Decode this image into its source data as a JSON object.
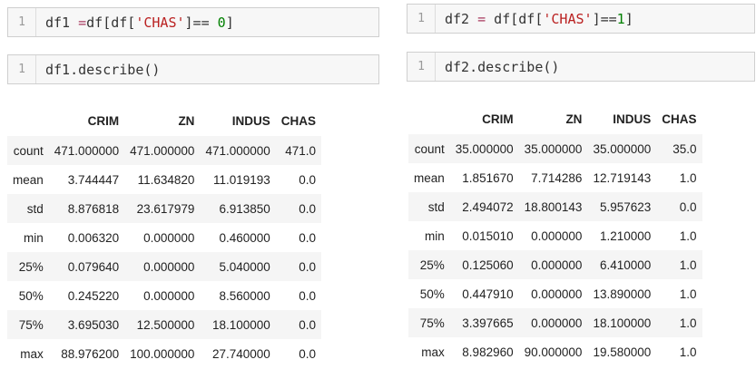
{
  "left": {
    "cell1": {
      "num": "1",
      "code_prefix": "df1 ",
      "code_eq": "=",
      "code_mid": "df[df[",
      "code_str": "'CHAS'",
      "code_cmp": "]== ",
      "code_num": "0",
      "code_end": "]"
    },
    "cell2": {
      "num": "1",
      "code": "df1.describe()"
    },
    "table": {
      "columns": [
        "CRIM",
        "ZN",
        "INDUS",
        "CHAS"
      ],
      "rows": [
        {
          "label": "count",
          "values": [
            "471.000000",
            "471.000000",
            "471.000000",
            "471.0"
          ]
        },
        {
          "label": "mean",
          "values": [
            "3.744447",
            "11.634820",
            "11.019193",
            "0.0"
          ]
        },
        {
          "label": "std",
          "values": [
            "8.876818",
            "23.617979",
            "6.913850",
            "0.0"
          ]
        },
        {
          "label": "min",
          "values": [
            "0.006320",
            "0.000000",
            "0.460000",
            "0.0"
          ]
        },
        {
          "label": "25%",
          "values": [
            "0.079640",
            "0.000000",
            "5.040000",
            "0.0"
          ]
        },
        {
          "label": "50%",
          "values": [
            "0.245220",
            "0.000000",
            "8.560000",
            "0.0"
          ]
        },
        {
          "label": "75%",
          "values": [
            "3.695030",
            "12.500000",
            "18.100000",
            "0.0"
          ]
        },
        {
          "label": "max",
          "values": [
            "88.976200",
            "100.000000",
            "27.740000",
            "0.0"
          ]
        }
      ]
    }
  },
  "right": {
    "cell1": {
      "num": "1",
      "code_prefix": "df2 ",
      "code_eq": "=",
      "code_mid": " df[df[",
      "code_str": "'CHAS'",
      "code_cmp": "]==",
      "code_num": "1",
      "code_end": "]"
    },
    "cell2": {
      "num": "1",
      "code": "df2.describe()"
    },
    "table": {
      "columns": [
        "CRIM",
        "ZN",
        "INDUS",
        "CHAS"
      ],
      "rows": [
        {
          "label": "count",
          "values": [
            "35.000000",
            "35.000000",
            "35.000000",
            "35.0"
          ]
        },
        {
          "label": "mean",
          "values": [
            "1.851670",
            "7.714286",
            "12.719143",
            "1.0"
          ]
        },
        {
          "label": "std",
          "values": [
            "2.494072",
            "18.800143",
            "5.957623",
            "0.0"
          ]
        },
        {
          "label": "min",
          "values": [
            "0.015010",
            "0.000000",
            "1.210000",
            "1.0"
          ]
        },
        {
          "label": "25%",
          "values": [
            "0.125060",
            "0.000000",
            "6.410000",
            "1.0"
          ]
        },
        {
          "label": "50%",
          "values": [
            "0.447910",
            "0.000000",
            "13.890000",
            "1.0"
          ]
        },
        {
          "label": "75%",
          "values": [
            "3.397665",
            "0.000000",
            "18.100000",
            "1.0"
          ]
        },
        {
          "label": "max",
          "values": [
            "8.982960",
            "90.000000",
            "19.580000",
            "1.0"
          ]
        }
      ]
    }
  }
}
